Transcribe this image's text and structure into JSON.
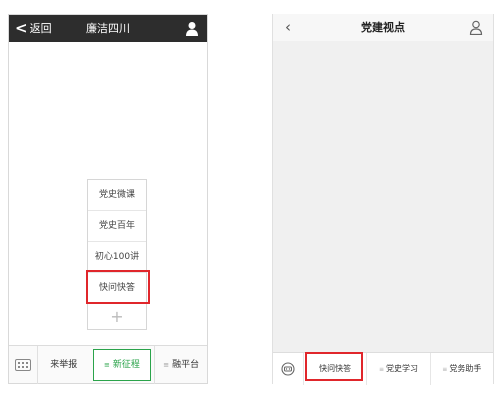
{
  "left_screen": {
    "back_label": "返回",
    "title": "廉洁四川",
    "popup_items": [
      "党史微课",
      "党史百年",
      "初心100讲",
      "快问快答"
    ],
    "popup_plus": "+",
    "bottom_tabs": [
      "来举报",
      "新征程",
      "融平台"
    ]
  },
  "right_screen": {
    "back_symbol": "‹",
    "title": "党建视点",
    "bottom_tabs": [
      "快问快答",
      "党史学习",
      "党务助手"
    ]
  },
  "colors": {
    "highlight_red": "#e0262b",
    "active_green": "#2aa34a",
    "topbar_dark": "#2d2d2d"
  }
}
